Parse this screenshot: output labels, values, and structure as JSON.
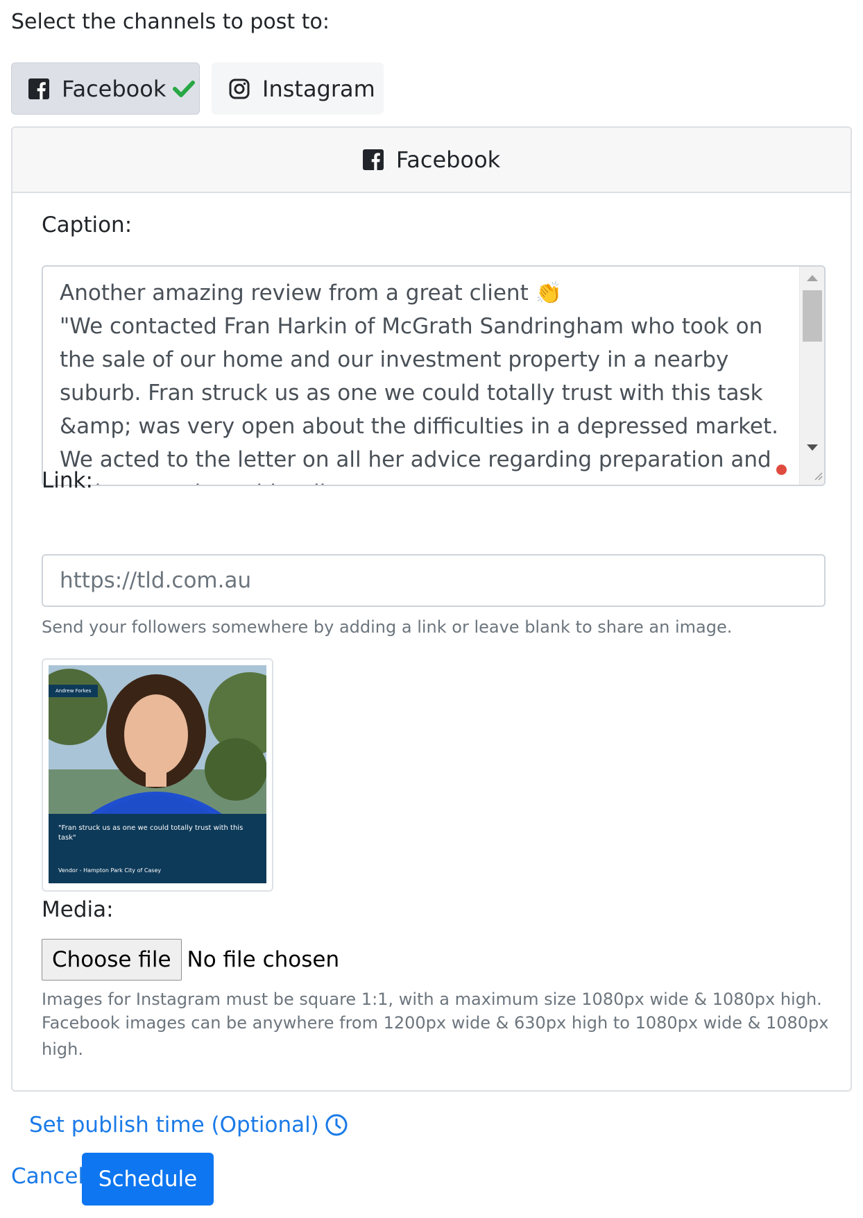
{
  "intro": "Select the channels to post to:",
  "channels": [
    {
      "label": "Facebook",
      "icon": "facebook-icon",
      "selected": true
    },
    {
      "label": "Instagram",
      "icon": "instagram-icon",
      "selected": false
    }
  ],
  "card": {
    "title": "Facebook",
    "caption_label": "Caption:",
    "caption_text": "Another amazing review from a great client 👏\n\"We contacted Fran Harkin of McGrath Sandringham who took on the sale of our home and our investment property in a nearby suburb. Fran struck us as one we could totally trust with this task &amp; was very open about the difficulties in a depressed market. We acted to the letter on all her advice regarding preparation and both properties sold well.",
    "link_label": "Link:",
    "link_placeholder": "https://tld.com.au",
    "link_help": "Send your followers somewhere by adding a link or leave blank to share an image.",
    "image": {
      "name_tag": "Andrew Forkes",
      "quote": "\"Fran struck us as one we could totally trust with this task\"",
      "vendor": "Vendor - Hampton Park City of Casey"
    },
    "media_label": "Media:",
    "choose_file": "Choose file",
    "no_file": "No file chosen",
    "media_help_1": "Images for Instagram must be square 1:1, with a maximum size 1080px wide & 1080px high.",
    "media_help_2": "Facebook images can be anywhere from 1200px wide & 630px high to 1080px wide & 1080px high."
  },
  "publish_time": "Set publish time (Optional)",
  "cancel": "Cancel",
  "schedule": "Schedule",
  "colors": {
    "primary": "#0d76f0",
    "link": "#1a7ae8",
    "check": "#28a745"
  }
}
